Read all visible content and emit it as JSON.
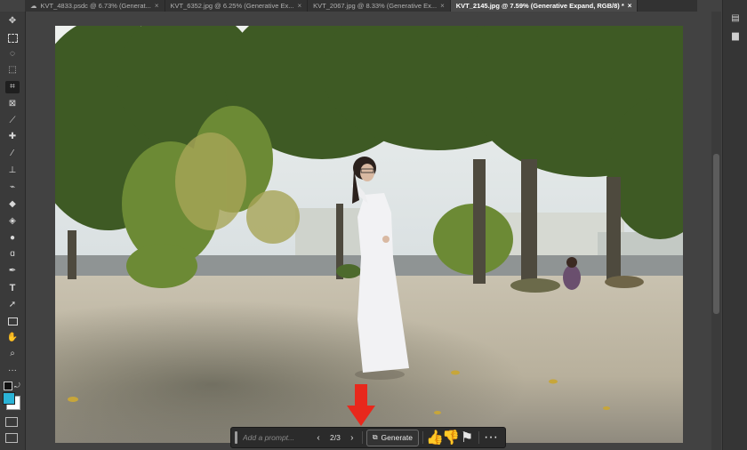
{
  "tabs": [
    {
      "label": "KVT_4833.psdc @ 6.73% (Generat...",
      "cloud": true,
      "active": false
    },
    {
      "label": "KVT_6352.jpg @ 6.25% (Generative Ex...",
      "cloud": false,
      "active": false
    },
    {
      "label": "KVT_2067.jpg @ 8.33% (Generative Ex...",
      "cloud": false,
      "active": false
    },
    {
      "label": "KVT_2145.jpg @ 7.59% (Generative Expand, RGB/8) *",
      "cloud": false,
      "active": true
    }
  ],
  "tools": [
    "move-tool",
    "marquee-tool",
    "lasso-tool",
    "object-selection-tool",
    "crop-tool",
    "frame-tool",
    "eyedropper-tool",
    "spot-healing-tool",
    "brush-tool",
    "clone-stamp-tool",
    "history-brush-tool",
    "eraser-tool",
    "paint-bucket-tool",
    "blur-tool",
    "dodge-tool",
    "pen-tool",
    "type-tool",
    "path-selection-tool",
    "rectangle-tool",
    "hand-tool",
    "zoom-tool",
    "more-tools"
  ],
  "colors": {
    "foreground": "#1a1a1a",
    "background": "#ffffff",
    "swatch_accent": "#2bb3d6",
    "arrow": "#e8281c"
  },
  "taskbar": {
    "prompt_placeholder": "Add a prompt...",
    "counter": "2/3",
    "generate_label": "Generate"
  }
}
